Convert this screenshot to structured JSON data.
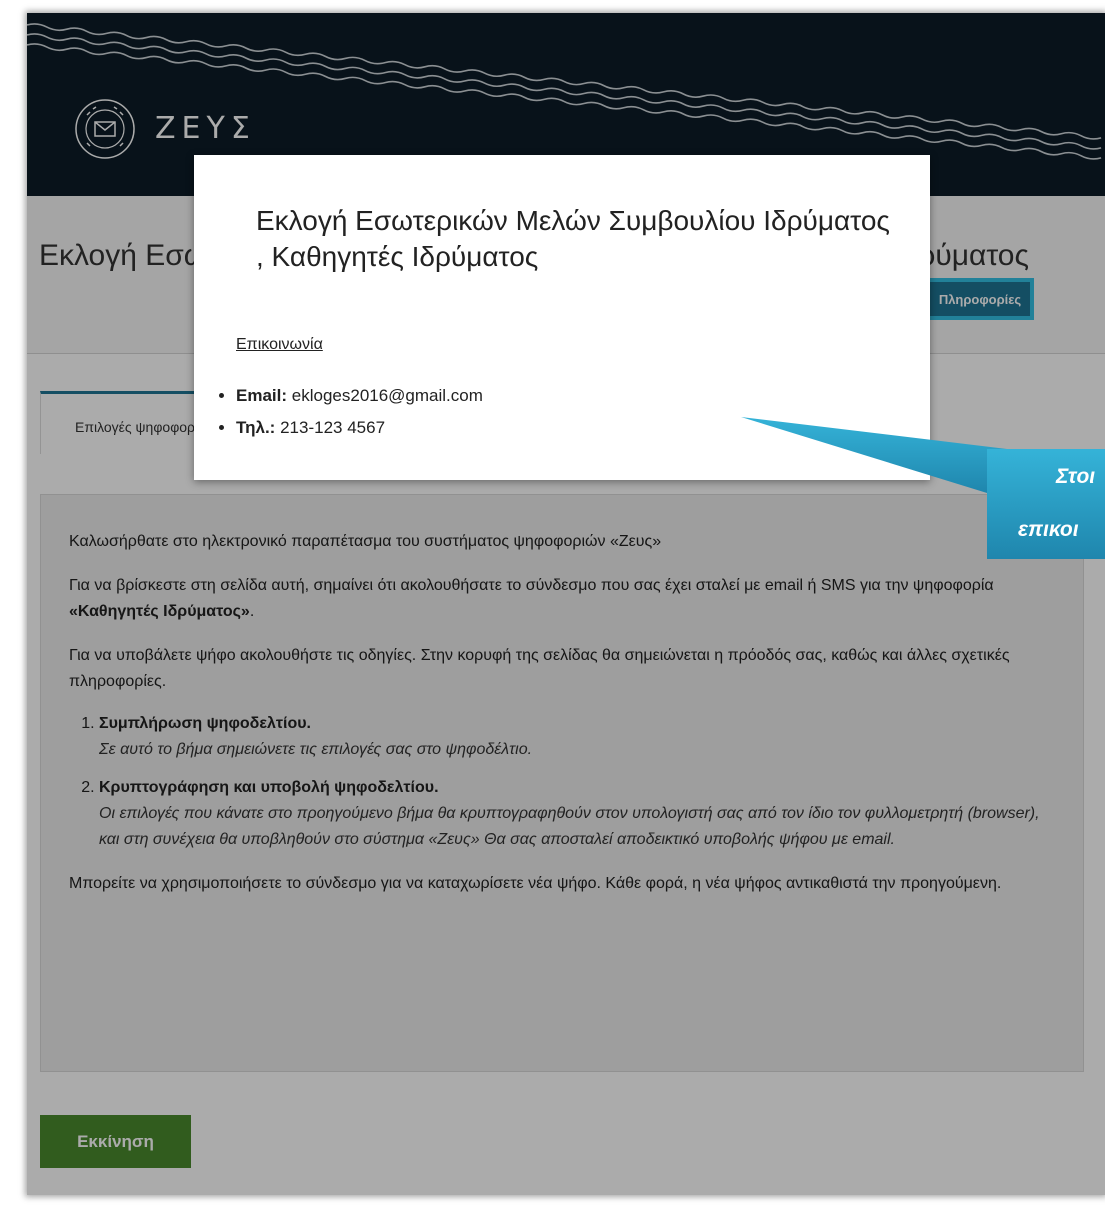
{
  "brand": {
    "name": "ΖΕΥΣ",
    "logo_icon": "digital-ballot-logo-icon"
  },
  "election": {
    "title": "Εκλογή Εσωτερικών Μελών Συμβουλίου Ιδρύματος , Καθηγητές Ιδρύματος"
  },
  "header": {
    "info_button_label": "Πληροφορίες"
  },
  "tabs": [
    {
      "label": "Επιλογές ψηφοφορίας"
    }
  ],
  "content": {
    "welcome": "Καλωσήρθατε στο ηλεκτρονικό παραπέτασμα του συστήματος ψηφοφοριών «Ζευς»",
    "link_intro": "Για να βρίσκεστε στη σελίδα αυτή, σημαίνει ότι ακολουθήσατε το σύνδεσμο που σας έχει σταλεί με email ή SMS για την ψηφοφορία ",
    "poll_name": "«Καθηγητές Ιδρύματος»",
    "poll_suffix": ".",
    "instructions": "Για να υποβάλετε ψήφο ακολουθήστε τις οδηγίες. Στην κορυφή της σελίδας θα σημειώνεται η πρόοδός σας, καθώς και άλλες σχετικές πληροφορίες.",
    "steps": [
      {
        "title": "Συμπλήρωση ψηφοδελτίου.",
        "desc": "Σε αυτό το βήμα σημειώνετε τις επιλογές σας στο ψηφοδέλτιο."
      },
      {
        "title": "Κρυπτογράφηση και υποβολή ψηφοδελτίου.",
        "desc": "Οι επιλογές που κάνατε στο προηγούμενο βήμα θα κρυπτογραφηθούν στον υπολογιστή σας από τον ίδιο τον φυλλομετρητή (browser), και στη συνέχεια θα υποβληθούν στο σύστημα «Ζευς» Θα σας αποσταλεί αποδεικτικό υποβολής ψήφου με email."
      }
    ],
    "revote_note": "Μπορείτε να χρησιμοποιήσετε το σύνδεσμο για να καταχωρίσετε νέα ψήφο. Κάθε φορά, η νέα ψήφος αντικαθιστά την προηγούμενη."
  },
  "start_button_label": "Εκκίνηση",
  "modal": {
    "title": "Εκλογή Εσωτερικών Μελών Συμβουλίου Ιδρύματος , Καθηγητές Ιδρύματος",
    "contact_heading": "Επικοινωνία",
    "email_label": "Email:",
    "email_value": "ekloges2016@gmail.com",
    "phone_label": "Τηλ.:",
    "phone_value": "213-123 4567"
  },
  "callout": {
    "line1": "Στοι",
    "line2": "επικοι",
    "color": "#2a9bbf"
  },
  "colors": {
    "header_bg": "#0c1c27",
    "accent": "#1f7594",
    "start_green": "#4a8a2d"
  }
}
